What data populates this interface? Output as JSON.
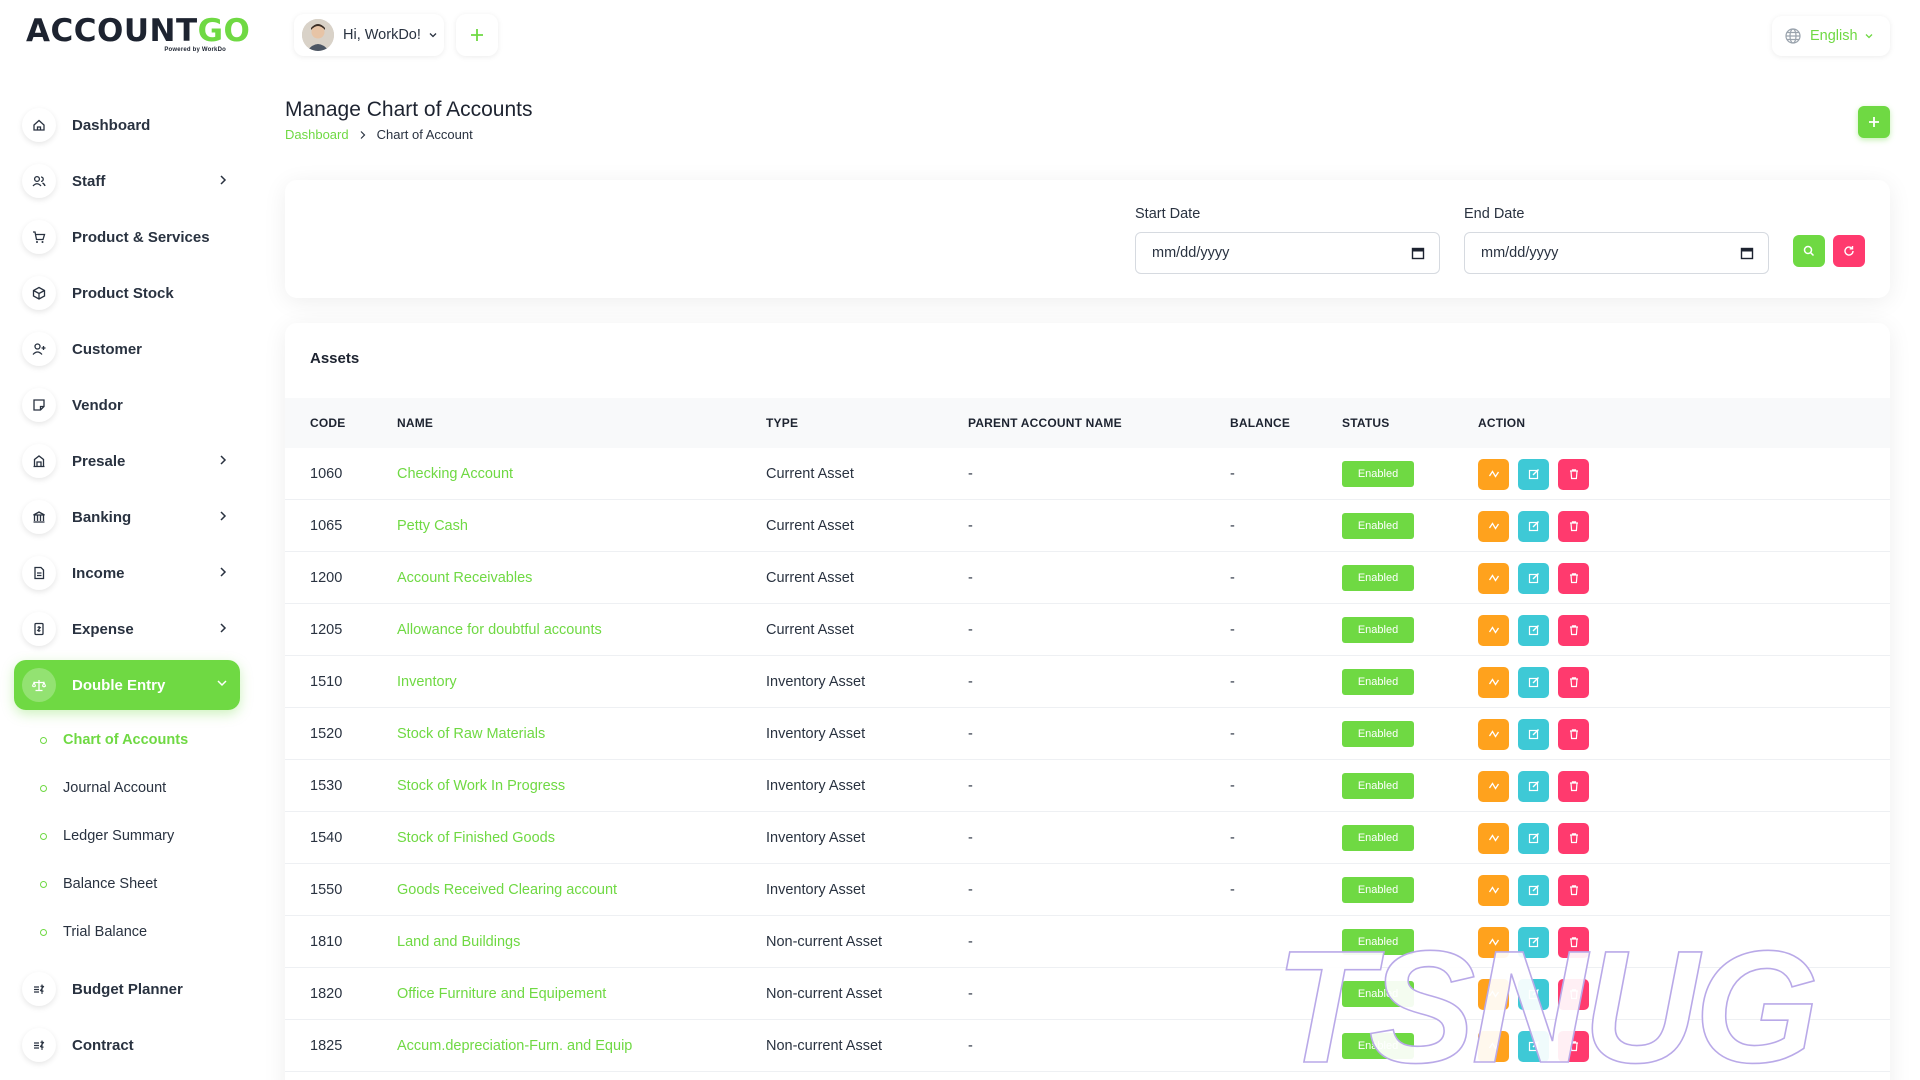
{
  "brand": {
    "logo_dark": "ACCOUNT",
    "logo_accent": "GO",
    "tagline": "Powered by WorkDo"
  },
  "colors": {
    "primary": "#6fd943",
    "orange": "#ffa21d",
    "cyan": "#3ec9d6",
    "red": "#ff3a6e",
    "text": "#293240"
  },
  "sidebar": {
    "items": [
      {
        "label": "Dashboard",
        "icon": "home-icon",
        "has_children": false
      },
      {
        "label": "Staff",
        "icon": "users-icon",
        "has_children": true
      },
      {
        "label": "Product & Services",
        "icon": "cart-icon",
        "has_children": false
      },
      {
        "label": "Product Stock",
        "icon": "box-icon",
        "has_children": false
      },
      {
        "label": "Customer",
        "icon": "user-plus-icon",
        "has_children": false
      },
      {
        "label": "Vendor",
        "icon": "note-icon",
        "has_children": false
      },
      {
        "label": "Presale",
        "icon": "building-icon",
        "has_children": true
      },
      {
        "label": "Banking",
        "icon": "bank-icon",
        "has_children": true
      },
      {
        "label": "Income",
        "icon": "file-invoice-icon",
        "has_children": true
      },
      {
        "label": "Expense",
        "icon": "receipt-icon",
        "has_children": true
      },
      {
        "label": "Double Entry",
        "icon": "scale-icon",
        "has_children": true,
        "active": true
      }
    ],
    "submenu": [
      {
        "label": "Chart of Accounts",
        "active": true
      },
      {
        "label": "Journal Account"
      },
      {
        "label": "Ledger Summary"
      },
      {
        "label": "Balance Sheet"
      },
      {
        "label": "Trial Balance"
      }
    ],
    "items_after": [
      {
        "label": "Budget Planner",
        "icon": "budget-icon"
      },
      {
        "label": "Contract",
        "icon": "contract-icon"
      }
    ]
  },
  "header": {
    "greeting": "Hi, WorkDo!",
    "language": "English"
  },
  "page": {
    "title": "Manage Chart of Accounts",
    "breadcrumb": {
      "home": "Dashboard",
      "current": "Chart of Account"
    }
  },
  "filter": {
    "start_label": "Start Date",
    "start_value": "mm/dd/yyyy",
    "end_label": "End Date",
    "end_value": "mm/dd/yyyy"
  },
  "table": {
    "title": "Assets",
    "columns": [
      "CODE",
      "NAME",
      "TYPE",
      "PARENT ACCOUNT NAME",
      "BALANCE",
      "STATUS",
      "ACTION"
    ],
    "rows": [
      {
        "code": "1060",
        "name": "Checking Account",
        "type": "Current Asset",
        "parent": "-",
        "balance": "-",
        "status": "Enabled"
      },
      {
        "code": "1065",
        "name": "Petty Cash",
        "type": "Current Asset",
        "parent": "-",
        "balance": "-",
        "status": "Enabled"
      },
      {
        "code": "1200",
        "name": "Account Receivables",
        "type": "Current Asset",
        "parent": "-",
        "balance": "-",
        "status": "Enabled"
      },
      {
        "code": "1205",
        "name": "Allowance for doubtful accounts",
        "type": "Current Asset",
        "parent": "-",
        "balance": "-",
        "status": "Enabled"
      },
      {
        "code": "1510",
        "name": "Inventory",
        "type": "Inventory Asset",
        "parent": "-",
        "balance": "-",
        "status": "Enabled"
      },
      {
        "code": "1520",
        "name": "Stock of Raw Materials",
        "type": "Inventory Asset",
        "parent": "-",
        "balance": "-",
        "status": "Enabled"
      },
      {
        "code": "1530",
        "name": "Stock of Work In Progress",
        "type": "Inventory Asset",
        "parent": "-",
        "balance": "-",
        "status": "Enabled"
      },
      {
        "code": "1540",
        "name": "Stock of Finished Goods",
        "type": "Inventory Asset",
        "parent": "-",
        "balance": "-",
        "status": "Enabled"
      },
      {
        "code": "1550",
        "name": "Goods Received Clearing account",
        "type": "Inventory Asset",
        "parent": "-",
        "balance": "-",
        "status": "Enabled"
      },
      {
        "code": "1810",
        "name": "Land and Buildings",
        "type": "Non-current Asset",
        "parent": "-",
        "balance": "",
        "status": "Enabled"
      },
      {
        "code": "1820",
        "name": "Office Furniture and Equipement",
        "type": "Non-current Asset",
        "parent": "-",
        "balance": "",
        "status": "Enabled"
      },
      {
        "code": "1825",
        "name": "Accum.depreciation-Furn. and Equip",
        "type": "Non-current Asset",
        "parent": "-",
        "balance": "",
        "status": "Enabled"
      }
    ]
  },
  "watermark": {
    "text": "TSNUG"
  }
}
